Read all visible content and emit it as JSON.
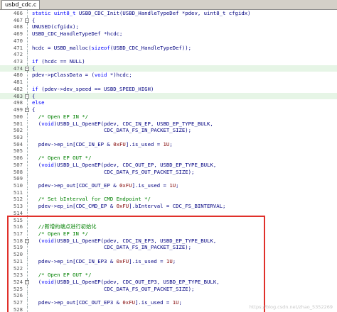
{
  "tab": {
    "title": "usbd_cdc.c"
  },
  "watermark": "https://blog.csdn.net/zhao_5352269",
  "lines": [
    {
      "num": "466",
      "fold": "",
      "code": [
        [
          "kw",
          "static uint8_t "
        ],
        [
          "tx",
          "USBD_CDC_Init(USBD_HandleTypeDef *pdev, uint8_t cfgidx)"
        ]
      ]
    },
    {
      "num": "467",
      "fold": "-",
      "code": [
        [
          "tx",
          "{"
        ]
      ]
    },
    {
      "num": "468",
      "fold": "",
      "code": [
        [
          "tx",
          "UNUSED(cfgidx);"
        ]
      ]
    },
    {
      "num": "469",
      "fold": "",
      "code": [
        [
          "tx",
          "USBD_CDC_HandleTypeDef *hcdc;"
        ]
      ]
    },
    {
      "num": "470",
      "fold": "",
      "code": []
    },
    {
      "num": "471",
      "fold": "",
      "code": [
        [
          "tx",
          "hcdc = USBD_malloc("
        ],
        [
          "kw",
          "sizeof"
        ],
        [
          "tx",
          "(USBD_CDC_HandleTypeDef));"
        ]
      ]
    },
    {
      "num": "472",
      "fold": "",
      "code": []
    },
    {
      "num": "473",
      "fold": "",
      "code": [
        [
          "kw",
          "if"
        ],
        [
          "tx",
          " (hcdc == NULL)"
        ]
      ]
    },
    {
      "num": "474",
      "fold": "-",
      "shaded": true,
      "code": [
        [
          "tx",
          "{"
        ]
      ]
    },
    {
      "num": "480",
      "fold": "",
      "code": [
        [
          "tx",
          "pdev->pClassData = ("
        ],
        [
          "kw",
          "void"
        ],
        [
          "tx",
          " *)hcdc;"
        ]
      ]
    },
    {
      "num": "481",
      "fold": "",
      "code": []
    },
    {
      "num": "482",
      "fold": "",
      "code": [
        [
          "kw",
          "if"
        ],
        [
          "tx",
          " (pdev->dev_speed == USBD_SPEED_HIGH)"
        ]
      ]
    },
    {
      "num": "483",
      "fold": "-",
      "shaded": true,
      "code": [
        [
          "tx",
          "{"
        ]
      ]
    },
    {
      "num": "498",
      "fold": "",
      "code": [
        [
          "kw",
          "else"
        ]
      ]
    },
    {
      "num": "499",
      "fold": "-",
      "code": [
        [
          "tx",
          "{"
        ]
      ]
    },
    {
      "num": "500",
      "fold": "",
      "code": [
        [
          "cm",
          "  /* Open EP IN */"
        ]
      ]
    },
    {
      "num": "501",
      "fold": "",
      "code": [
        [
          "tx",
          "  ("
        ],
        [
          "kw",
          "void"
        ],
        [
          "tx",
          ")USBD_LL_OpenEP(pdev, CDC_IN_EP, USBD_EP_TYPE_BULK,"
        ]
      ]
    },
    {
      "num": "502",
      "fold": "",
      "code": [
        [
          "tx",
          "                       CDC_DATA_FS_IN_PACKET_SIZE);"
        ]
      ]
    },
    {
      "num": "503",
      "fold": "",
      "code": []
    },
    {
      "num": "504",
      "fold": "",
      "code": [
        [
          "tx",
          "  pdev->ep_in[CDC_IN_EP & "
        ],
        [
          "hx",
          "0xFU"
        ],
        [
          "tx",
          "].is_used = "
        ],
        [
          "hx",
          "1U"
        ],
        [
          "tx",
          ";"
        ]
      ]
    },
    {
      "num": "505",
      "fold": "",
      "code": []
    },
    {
      "num": "506",
      "fold": "",
      "code": [
        [
          "cm",
          "  /* Open EP OUT */"
        ]
      ]
    },
    {
      "num": "507",
      "fold": "",
      "code": [
        [
          "tx",
          "  ("
        ],
        [
          "kw",
          "void"
        ],
        [
          "tx",
          ")USBD_LL_OpenEP(pdev, CDC_OUT_EP, USBD_EP_TYPE_BULK,"
        ]
      ]
    },
    {
      "num": "508",
      "fold": "",
      "code": [
        [
          "tx",
          "                       CDC_DATA_FS_OUT_PACKET_SIZE);"
        ]
      ]
    },
    {
      "num": "509",
      "fold": "",
      "code": []
    },
    {
      "num": "510",
      "fold": "",
      "code": [
        [
          "tx",
          "  pdev->ep_out[CDC_OUT_EP & "
        ],
        [
          "hx",
          "0xFU"
        ],
        [
          "tx",
          "].is_used = "
        ],
        [
          "hx",
          "1U"
        ],
        [
          "tx",
          ";"
        ]
      ]
    },
    {
      "num": "511",
      "fold": "",
      "code": []
    },
    {
      "num": "512",
      "fold": "",
      "code": [
        [
          "cm",
          "  /* Set bInterval for CMD Endpoint */"
        ]
      ]
    },
    {
      "num": "513",
      "fold": "",
      "code": [
        [
          "tx",
          "  pdev->ep_in[CDC_CMD_EP & "
        ],
        [
          "hx",
          "0xFU"
        ],
        [
          "tx",
          "].bInterval = CDC_FS_BINTERVAL;"
        ]
      ]
    },
    {
      "num": "514",
      "fold": "",
      "code": []
    },
    {
      "num": "515",
      "fold": "",
      "code": []
    },
    {
      "num": "516",
      "fold": "",
      "code": [
        [
          "cm",
          "  //新增的端点进行初始化"
        ]
      ]
    },
    {
      "num": "517",
      "fold": "",
      "code": [
        [
          "cm",
          "  /* Open EP IN */"
        ]
      ]
    },
    {
      "num": "518",
      "fold": "-",
      "code": [
        [
          "tx",
          "  ("
        ],
        [
          "kw",
          "void"
        ],
        [
          "tx",
          ")USBD_LL_OpenEP(pdev, CDC_IN_EP3, USBD_EP_TYPE_BULK,"
        ]
      ]
    },
    {
      "num": "519",
      "fold": "",
      "code": [
        [
          "tx",
          "                       CDC_DATA_FS_IN_PACKET_SIZE);"
        ]
      ]
    },
    {
      "num": "520",
      "fold": "",
      "code": []
    },
    {
      "num": "521",
      "fold": "",
      "code": [
        [
          "tx",
          "  pdev->ep_in[CDC_IN_EP3 & "
        ],
        [
          "hx",
          "0xFU"
        ],
        [
          "tx",
          "].is_used = "
        ],
        [
          "hx",
          "1U"
        ],
        [
          "tx",
          ";"
        ]
      ]
    },
    {
      "num": "522",
      "fold": "",
      "code": []
    },
    {
      "num": "523",
      "fold": "",
      "code": [
        [
          "cm",
          "  /* Open EP OUT */"
        ]
      ]
    },
    {
      "num": "524",
      "fold": "-",
      "code": [
        [
          "tx",
          "  ("
        ],
        [
          "kw",
          "void"
        ],
        [
          "tx",
          ")USBD_LL_OpenEP(pdev, CDC_OUT_EP3, USBD_EP_TYPE_BULK,"
        ]
      ]
    },
    {
      "num": "525",
      "fold": "",
      "code": [
        [
          "tx",
          "                       CDC_DATA_FS_OUT_PACKET_SIZE);"
        ]
      ]
    },
    {
      "num": "526",
      "fold": "",
      "code": []
    },
    {
      "num": "527",
      "fold": "",
      "code": [
        [
          "tx",
          "  pdev->ep_out[CDC_OUT_EP3 & "
        ],
        [
          "hx",
          "0xFU"
        ],
        [
          "tx",
          "].is_used = "
        ],
        [
          "hx",
          "1U"
        ],
        [
          "tx",
          ";"
        ]
      ]
    },
    {
      "num": "528",
      "fold": "",
      "code": []
    },
    {
      "num": "529",
      "fold": "",
      "code": [
        [
          "cm",
          "  /* Set bInterval for CMD Endpoint */"
        ]
      ]
    },
    {
      "num": "530",
      "fold": "",
      "code": [
        [
          "tx",
          "  pdev->ep_in[CDC_CMD_EP4 & "
        ],
        [
          "hx",
          "0xFU"
        ],
        [
          "tx",
          "].bInterval = CDC_FS_BINTERVAL;"
        ]
      ]
    }
  ]
}
